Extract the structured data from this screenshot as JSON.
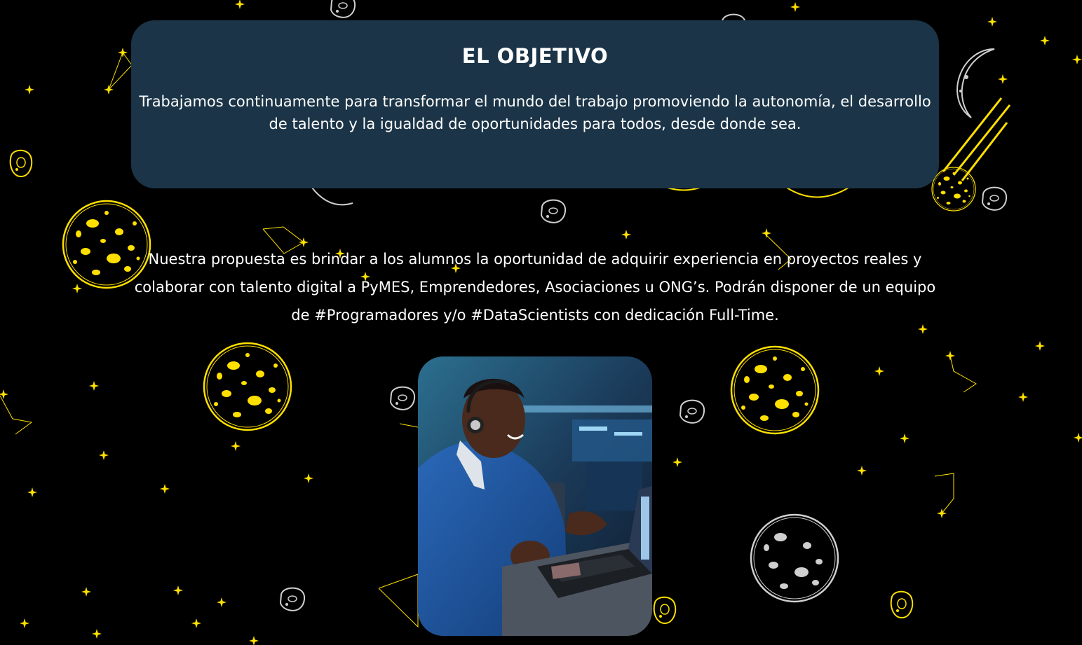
{
  "objective": {
    "title": "EL OBJETIVO",
    "text": "Trabajamos continuamente para transformar el mundo del trabajo promoviendo la autonomía, el desarrollo de talento y la igualdad de oportunidades para todos, desde donde sea."
  },
  "proposal": {
    "text": "Nuestra propuesta es brindar a los alumnos la oportunidad de adquirir experiencia en proyectos reales y colaborar con talento digital a PyMES, Emprendedores, Asociaciones u ONG’s. Podrán disponer de un equipo de #Programadores y/o #DataScientists con dedicación Full-Time."
  },
  "decorations": {
    "background": "space-scene",
    "icons": [
      "star-icon",
      "planet-icon",
      "moon-icon",
      "asteroid-icon",
      "constellation-icon",
      "comet-icon"
    ]
  },
  "photo": {
    "subject": "developer-with-headset-laptop-photo"
  },
  "colors": {
    "background": "#000000",
    "card": "#1b3447",
    "accent": "#ffe000",
    "text": "#ffffff"
  }
}
